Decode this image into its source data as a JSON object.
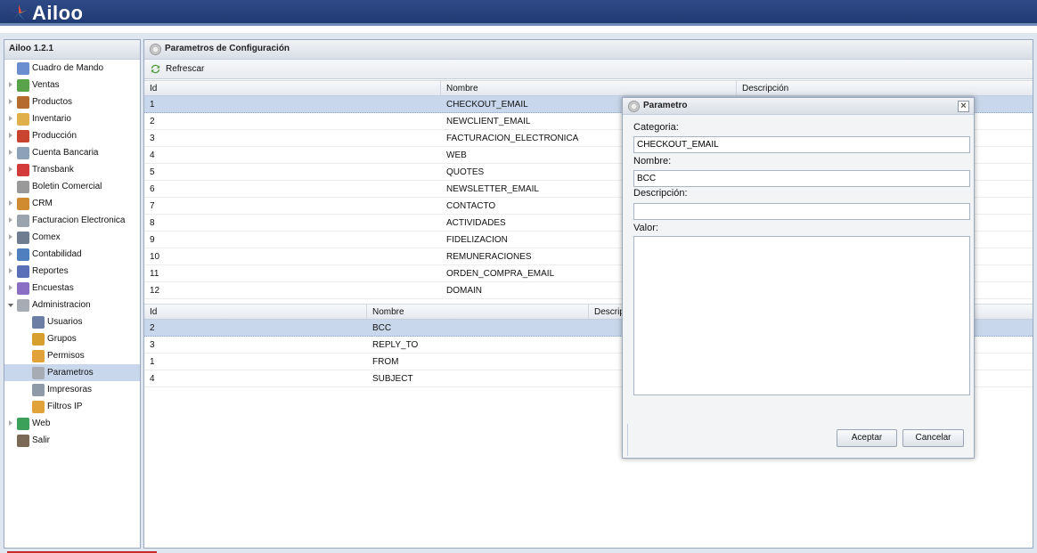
{
  "app": {
    "name": "Ailoo",
    "version": "Ailoo 1.2.1"
  },
  "sidebar": {
    "items": [
      {
        "label": "Cuadro de Mando",
        "icon": "chart-icon",
        "color": "#6a8ed0",
        "expandable": false,
        "level": 0
      },
      {
        "label": "Ventas",
        "icon": "money-icon",
        "color": "#58a34a",
        "expandable": true,
        "level": 0
      },
      {
        "label": "Productos",
        "icon": "box-icon",
        "color": "#b56a2e",
        "expandable": true,
        "level": 0
      },
      {
        "label": "Inventario",
        "icon": "package-icon",
        "color": "#e0b04a",
        "expandable": true,
        "level": 0
      },
      {
        "label": "Producción",
        "icon": "factory-icon",
        "color": "#c9442e",
        "expandable": true,
        "level": 0
      },
      {
        "label": "Cuenta Bancaria",
        "icon": "calculator-icon",
        "color": "#8da2b8",
        "expandable": true,
        "level": 0
      },
      {
        "label": "Transbank",
        "icon": "transbank-icon",
        "color": "#d33b3b",
        "expandable": true,
        "level": 0
      },
      {
        "label": "Boletin Comercial",
        "icon": "tag-icon",
        "color": "#999999",
        "expandable": false,
        "level": 0
      },
      {
        "label": "CRM",
        "icon": "users-icon",
        "color": "#d08a2f",
        "expandable": true,
        "level": 0
      },
      {
        "label": "Facturacion Electronica",
        "icon": "invoice-icon",
        "color": "#9aa3ae",
        "expandable": true,
        "level": 0
      },
      {
        "label": "Comex",
        "icon": "truck-icon",
        "color": "#6f7d90",
        "expandable": true,
        "level": 0
      },
      {
        "label": "Contabilidad",
        "icon": "ledger-icon",
        "color": "#4f7fbf",
        "expandable": true,
        "level": 0
      },
      {
        "label": "Reportes",
        "icon": "report-icon",
        "color": "#5a6fb8",
        "expandable": true,
        "level": 0
      },
      {
        "label": "Encuestas",
        "icon": "survey-icon",
        "color": "#8a6fc4",
        "expandable": true,
        "level": 0
      },
      {
        "label": "Administracion",
        "icon": "gear-icon",
        "color": "#a7acb4",
        "expandable": true,
        "expanded": true,
        "level": 0
      },
      {
        "label": "Usuarios",
        "icon": "user-icon",
        "color": "#6c7ea3",
        "expandable": false,
        "level": 1
      },
      {
        "label": "Grupos",
        "icon": "group-icon",
        "color": "#d7a02e",
        "expandable": false,
        "level": 1
      },
      {
        "label": "Permisos",
        "icon": "lock-icon",
        "color": "#e2a23a",
        "expandable": false,
        "level": 1
      },
      {
        "label": "Parametros",
        "icon": "gear-icon",
        "color": "#a7acb4",
        "expandable": false,
        "level": 1,
        "selected": true
      },
      {
        "label": "Impresoras",
        "icon": "printer-icon",
        "color": "#8f9aa8",
        "expandable": false,
        "level": 1
      },
      {
        "label": "Filtros IP",
        "icon": "lock-icon",
        "color": "#e2a23a",
        "expandable": false,
        "level": 1
      },
      {
        "label": "Web",
        "icon": "globe-icon",
        "color": "#3aa05a",
        "expandable": true,
        "level": 0
      },
      {
        "label": "Salir",
        "icon": "exit-door-icon",
        "color": "#7a6a55",
        "expandable": false,
        "level": 0
      }
    ]
  },
  "content": {
    "title": "Parametros de Configuración",
    "refresh_label": "Refrescar",
    "categories": {
      "headers": [
        "Id",
        "Nombre",
        "Descripción"
      ],
      "rows": [
        [
          "1",
          "CHECKOUT_EMAIL",
          ""
        ],
        [
          "2",
          "NEWCLIENT_EMAIL",
          ""
        ],
        [
          "3",
          "FACTURACION_ELECTRONICA",
          ""
        ],
        [
          "4",
          "WEB",
          ""
        ],
        [
          "5",
          "QUOTES",
          ""
        ],
        [
          "6",
          "NEWSLETTER_EMAIL",
          ""
        ],
        [
          "7",
          "CONTACTO",
          ""
        ],
        [
          "8",
          "ACTIVIDADES",
          ""
        ],
        [
          "9",
          "FIDELIZACION",
          ""
        ],
        [
          "10",
          "REMUNERACIONES",
          ""
        ],
        [
          "11",
          "ORDEN_COMPRA_EMAIL",
          ""
        ],
        [
          "12",
          "DOMAIN",
          ""
        ]
      ]
    },
    "parameters": {
      "headers": [
        "Id",
        "Nombre",
        "Descrip"
      ],
      "rows": [
        [
          "2",
          "BCC",
          ""
        ],
        [
          "3",
          "REPLY_TO",
          ""
        ],
        [
          "1",
          "FROM",
          ""
        ],
        [
          "4",
          "SUBJECT",
          ""
        ]
      ]
    }
  },
  "dialog": {
    "title": "Parametro",
    "categoria_label": "Categoria:",
    "categoria_value": "CHECKOUT_EMAIL",
    "nombre_label": "Nombre:",
    "nombre_value": "BCC",
    "descripcion_label": "Descripción:",
    "descripcion_value": "",
    "valor_label": "Valor:",
    "valor_value": "",
    "accept_label": "Aceptar",
    "cancel_label": "Cancelar",
    "close_symbol": "×"
  }
}
